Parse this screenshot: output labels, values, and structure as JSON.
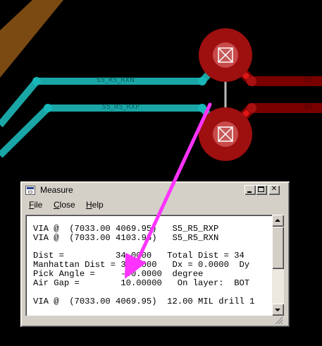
{
  "pcb": {
    "traces": [
      {
        "net": "S5_R5_RXN",
        "color": "#1aa6a6"
      },
      {
        "net": "S5_R5_RXP",
        "color": "#1aa6a6"
      }
    ],
    "right_trace_labels": [
      "S5_",
      "S5_"
    ],
    "colors": {
      "background": "#000000",
      "teal_trace": "#1aa6a6",
      "red_trace": "#7a0000",
      "via_pad": "#9e0f0f",
      "brown_trace": "#7a4a12",
      "measure_arrow": "#ff33ff"
    }
  },
  "window": {
    "title": "Measure",
    "buttons": [
      "minimize",
      "maximize",
      "close"
    ],
    "menu": [
      {
        "label": "File",
        "accel": "F",
        "rest": "ile"
      },
      {
        "label": "Close",
        "accel": "C",
        "rest": "lose"
      },
      {
        "label": "Help",
        "accel": "H",
        "rest": "elp"
      }
    ],
    "lines": [
      "VIA @  (7033.00 4069.95)   S5_R5_RXP",
      "VIA @  (7033.00 4103.95)   S5_R5_RXN",
      "",
      "Dist =          34.0000   Total Dist = 34",
      "Manhattan Dist = 34.0000   Dx = 0.0000  Dy",
      "Pick Angle =     -90.0000  degree",
      "Air Gap =        10.00000   On layer:  BOT",
      "",
      "VIA @  (7033.00 4069.95)  12.00 MIL drill 1"
    ]
  }
}
